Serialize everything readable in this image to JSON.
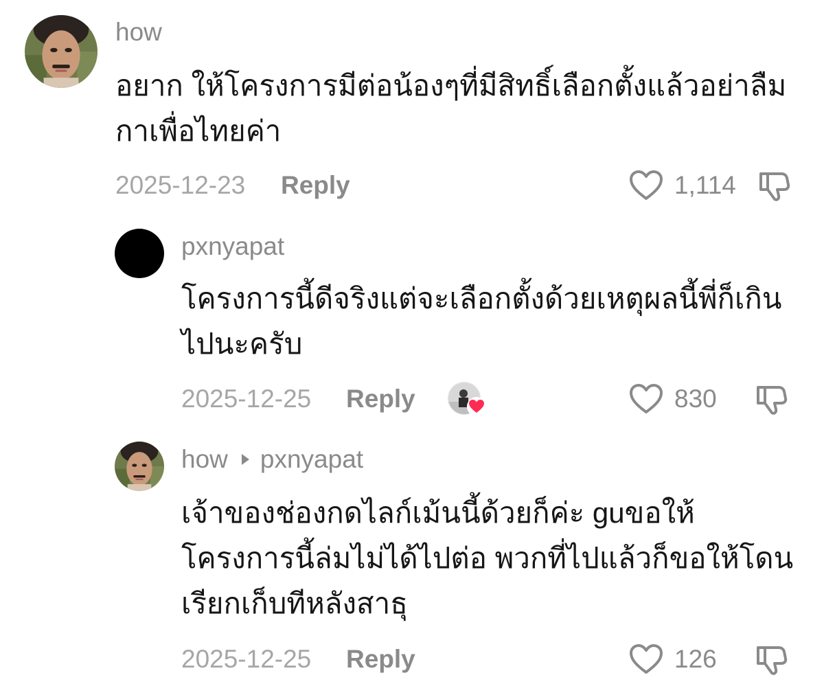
{
  "comments": [
    {
      "username": "how",
      "reply_to": "",
      "text": "อยาก ให้โครงการมีต่อน้องๆที่มีสิทธิ์เลือกตั้งแล้วอย่าลืม กาเพื่อไทยค่า",
      "date": "2025-12-23",
      "reply_label": "Reply",
      "likes": "1,114",
      "avatar_icon": "user-avatar-photo"
    },
    {
      "username": "pxnyapat",
      "reply_to": "",
      "text": "โครงการนี้ดีจริงแต่จะเลือกตั้งด้วยเหตุผลนี้พี่ก็เกิน ไปนะครับ",
      "date": "2025-12-25",
      "reply_label": "Reply",
      "likes": "830",
      "avatar_icon": "black-avatar",
      "creator_liked": true
    },
    {
      "username": "how",
      "reply_to": "pxnyapat",
      "text": "เจ้าของช่องกดไลก์เม้นนี้ด้วยก็ค่ะ guขอให้ โครงการนี้ล่มไม่ได้ไปต่อ พวกที่ไปแล้วก็ขอให้โดน เรียกเก็บทีหลังสาธุ",
      "date": "2025-12-25",
      "reply_label": "Reply",
      "likes": "126",
      "avatar_icon": "user-avatar-photo"
    }
  ],
  "colors": {
    "text_primary": "#161616",
    "text_secondary": "#8a8a8a",
    "date_color": "#a6a6a6",
    "heart_badge": "#fe2c55"
  }
}
